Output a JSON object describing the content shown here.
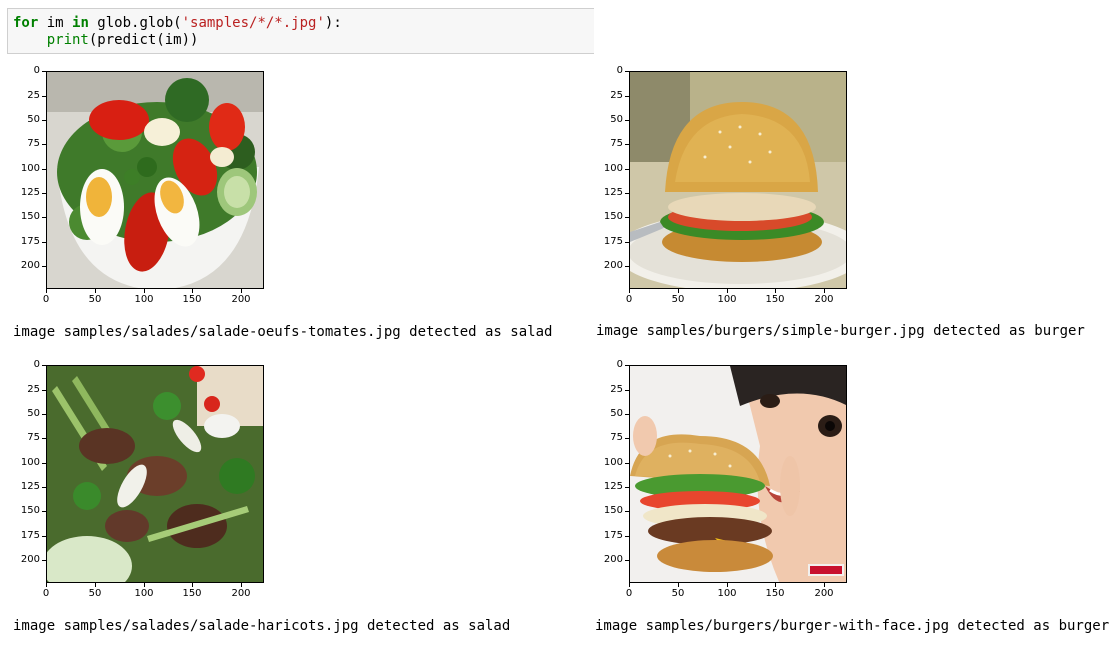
{
  "code_cell": {
    "line1": {
      "kw_for": "for",
      "var": " im ",
      "kw_in": "in",
      "call": " glob.glob(",
      "str": "'samples/*/*.jpg'",
      "end": "):"
    },
    "line2": {
      "indent": "    ",
      "fn_print": "print",
      "rest": "(predict(im))"
    }
  },
  "axis": {
    "y_ticks": [
      "0",
      "25",
      "50",
      "75",
      "100",
      "125",
      "150",
      "175",
      "200"
    ],
    "x_ticks": [
      "0",
      "50",
      "100",
      "150",
      "200"
    ]
  },
  "outputs": [
    {
      "image_subject": "egg-tomato-salad",
      "text": "image samples/salades/salade-oeufs-tomates.jpg detected as salad"
    },
    {
      "image_subject": "simple-burger",
      "text": "image samples/burgers/simple-burger.jpg detected as burger"
    },
    {
      "image_subject": "bean-salad",
      "text": "image samples/salades/salade-haricots.jpg detected as salad"
    },
    {
      "image_subject": "burger-with-face",
      "text": "image samples/burgers/burger-with-face.jpg detected as burger"
    }
  ]
}
